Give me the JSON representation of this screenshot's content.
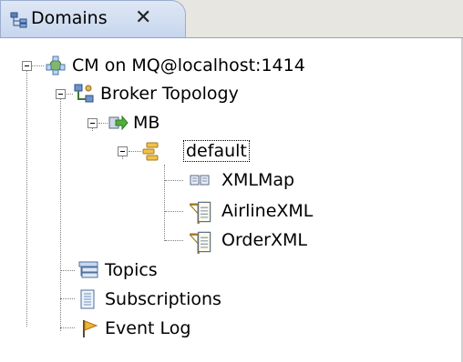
{
  "tab": {
    "title": "Domains",
    "close_label": "✕"
  },
  "tree": {
    "domain": "CM on MQ@localhost:1414",
    "topology": "Broker Topology",
    "broker": "MB",
    "execution_group": "default",
    "flows": [
      "XMLMap",
      "AirlineXML",
      "OrderXML"
    ],
    "topics": "Topics",
    "subscriptions": "Subscriptions",
    "event_log": "Event Log"
  }
}
